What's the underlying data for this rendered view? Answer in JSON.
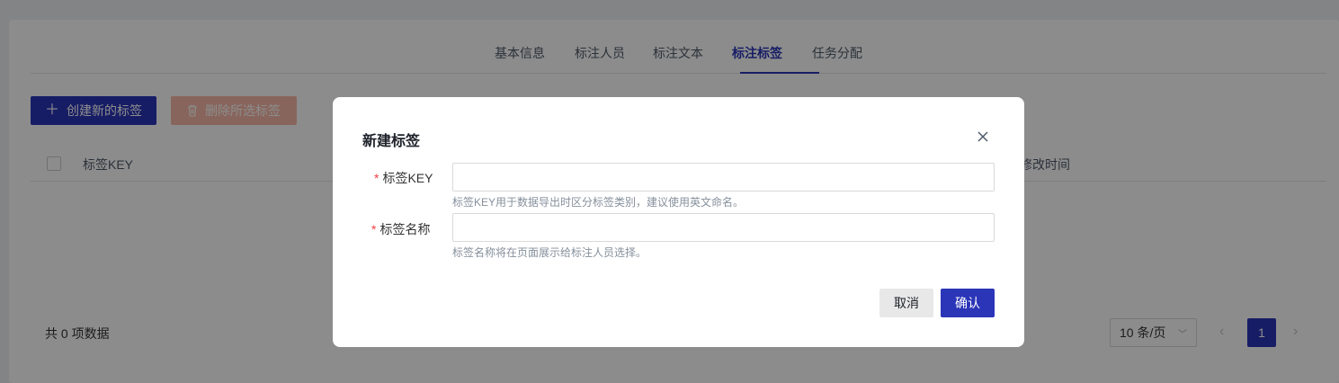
{
  "tabs": [
    {
      "label": "基本信息"
    },
    {
      "label": "标注人员"
    },
    {
      "label": "标注文本"
    },
    {
      "label": "标注标签",
      "active": true
    },
    {
      "label": "任务分配"
    }
  ],
  "toolbar": {
    "create_label": "创建新的标签",
    "create_icon": "plus-icon",
    "delete_label": "删除所选标签",
    "delete_icon": "trash-icon"
  },
  "table": {
    "columns": [
      "标签KEY",
      "修改时间"
    ]
  },
  "footer": {
    "total_text": "共 0 项数据",
    "page_size": "10 条/页",
    "current_page": "1"
  },
  "modal": {
    "title": "新建标签",
    "close_icon": "close-icon",
    "fields": [
      {
        "required_mark": "*",
        "label": "标签KEY",
        "value": "",
        "hint": "标签KEY用于数据导出时区分标签类别，建议使用英文命名。"
      },
      {
        "required_mark": "*",
        "label": "标签名称",
        "value": "",
        "hint": "标签名称将在页面展示给标注人员选择。"
      }
    ],
    "cancel_label": "取消",
    "confirm_label": "确认"
  },
  "colors": {
    "primary": "#2b35b8",
    "danger_disabled": "#f7b8a8",
    "required": "#f53f3f"
  }
}
